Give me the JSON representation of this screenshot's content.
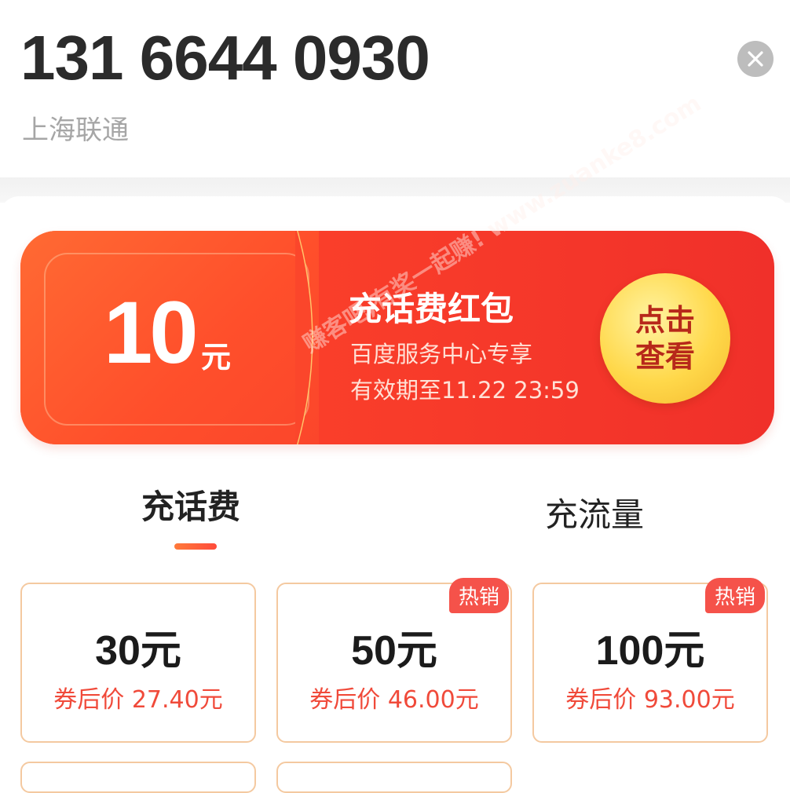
{
  "header": {
    "phone_number": "131 6644 0930",
    "carrier": "上海联通",
    "close_icon": "close-icon"
  },
  "banner": {
    "amount": "10",
    "amount_unit": "元",
    "title": "充话费红包",
    "line1": "百度服务中心专享",
    "line2": "有效期至11.22 23:59",
    "cta_line1": "点击",
    "cta_line2": "查看",
    "watermark": "赚客吧,有奖一起赚! www.zuanke8.com"
  },
  "tabs": [
    {
      "label": "充话费",
      "active": true
    },
    {
      "label": "充流量",
      "active": false
    }
  ],
  "products": [
    {
      "face": "30元",
      "price": "券后价 27.40元",
      "badge": ""
    },
    {
      "face": "50元",
      "price": "券后价 46.00元",
      "badge": "热销"
    },
    {
      "face": "100元",
      "price": "券后价 93.00元",
      "badge": "热销"
    }
  ],
  "colors": {
    "accent_red": "#f04a3a",
    "banner_red": "#f93d2a",
    "cta_yellow": "#ffd84a",
    "card_border": "#f4c9a0"
  }
}
